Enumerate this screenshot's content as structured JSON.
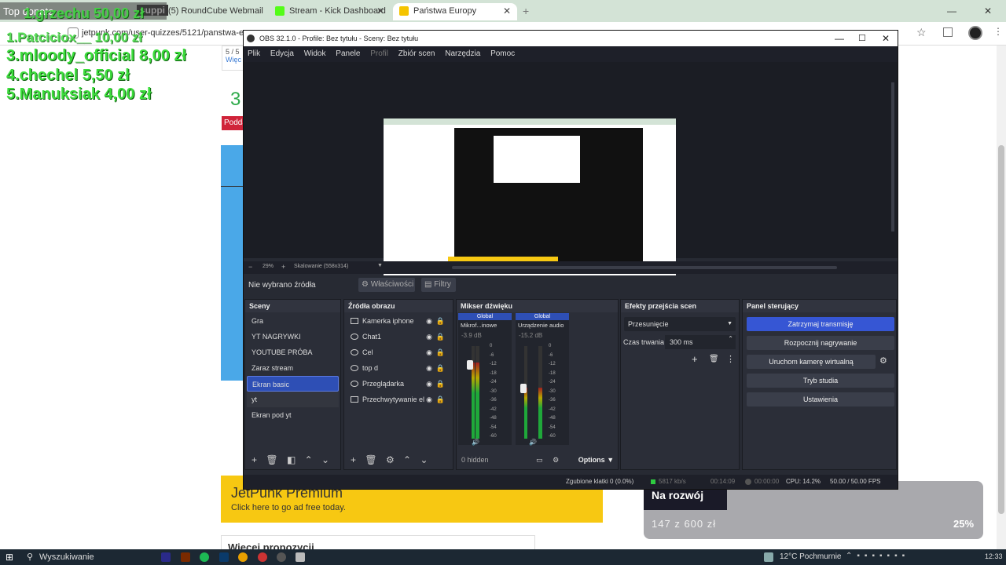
{
  "browser": {
    "tabs": [
      {
        "label": "(5) RoundCube Webmail :: Odet",
        "color": "#444"
      },
      {
        "label": "Stream - Kick Dashboard",
        "color": "#53fc18"
      },
      {
        "label": "Państwa Europy",
        "color": "#f5c400"
      }
    ],
    "url": "jetpunk.com/user-quizzes/5121/panstwa-europy",
    "overlay_logo": "suppi"
  },
  "top_donate": {
    "title": "Top donate",
    "user_label": "Latino67",
    "entries": [
      "1.grzechu  50,00 zł",
      "1.Patciciox__ 10,00 zł",
      "3.mloody_official  8,00 zł",
      "4.chechel  5,50 zł",
      "5.Manuksiak  4,00 zł"
    ]
  },
  "webpage": {
    "count_text": "5 / 5",
    "more_link": "Więc",
    "big_digit": "3",
    "tag_red": "Podda",
    "premium_title": "JetPunk Premium",
    "premium_sub": "Click here to go ad free today.",
    "more_suggestions": "Więcej propozycji",
    "goal": {
      "title": "Na rozwój",
      "current": "147",
      "sep": "z",
      "target": "600",
      "currency": "zł",
      "percent_text": "25%",
      "fraction": 0.245
    }
  },
  "obs": {
    "title": "OBS 32.1.0 - Profile: Bez tytułu - Sceny: Bez tytułu",
    "menu": [
      "Plik",
      "Edycja",
      "Widok",
      "Panele",
      "Profil",
      "Zbiór scen",
      "Narzędzia",
      "Pomoc"
    ],
    "zoom": "29%",
    "scale_label": "Skalowanie (558x314)",
    "no_source": "Nie wybrano źródła",
    "properties": "Właściwości",
    "filters": "Filtry",
    "docks": {
      "scenes": "Sceny",
      "sources": "Źródła obrazu",
      "mixer": "Mikser dźwięku",
      "transitions": "Efekty przejścia scen",
      "controls": "Panel sterujący"
    },
    "scenes": [
      "Gra",
      "YT NAGRYWKI",
      "YOUTUBE PRÓBA",
      "Zaraz stream",
      "Ekran basic",
      "yt",
      "Ekran pod yt"
    ],
    "selected_scene": 4,
    "sources": [
      "Kamerka iphone",
      "Chat1",
      "Cel",
      "top d",
      "Przeglądarka",
      "Przechwytywanie el"
    ],
    "mixer": {
      "channels": [
        {
          "tag": "Global",
          "name": "Mikrof...inowe",
          "db": "-3.9 dB",
          "level": 0.82
        },
        {
          "tag": "Global",
          "name": "Urządzenie audio",
          "db": "-15.2 dB",
          "level": 0.55
        }
      ],
      "scale": [
        "0",
        "-6",
        "-12",
        "-18",
        "-24",
        "-30",
        "-36",
        "-42",
        "-48",
        "-54",
        "-60"
      ],
      "hidden": "0 hidden",
      "options": "Options"
    },
    "transition": {
      "type": "Przesunięcie",
      "duration_label": "Czas trwania",
      "duration": "300 ms"
    },
    "controls": [
      "Zatrzymaj transmisję",
      "Rozpocznij nagrywanie",
      "Uruchom kamerę wirtualną",
      "Tryb studia",
      "Ustawienia"
    ],
    "status": {
      "dropped": "Zgubione klatki 0 (0.0%)",
      "bitrate": "5817 kb/s",
      "stream_time": "00:14:09",
      "rec_time": "00:00:00",
      "cpu": "CPU: 14.2%",
      "fps": "50.00 / 50.00 FPS"
    }
  },
  "taskbar": {
    "search": "Wyszukiwanie",
    "weather": "12°C  Pochmurnie",
    "time": "12:33"
  }
}
